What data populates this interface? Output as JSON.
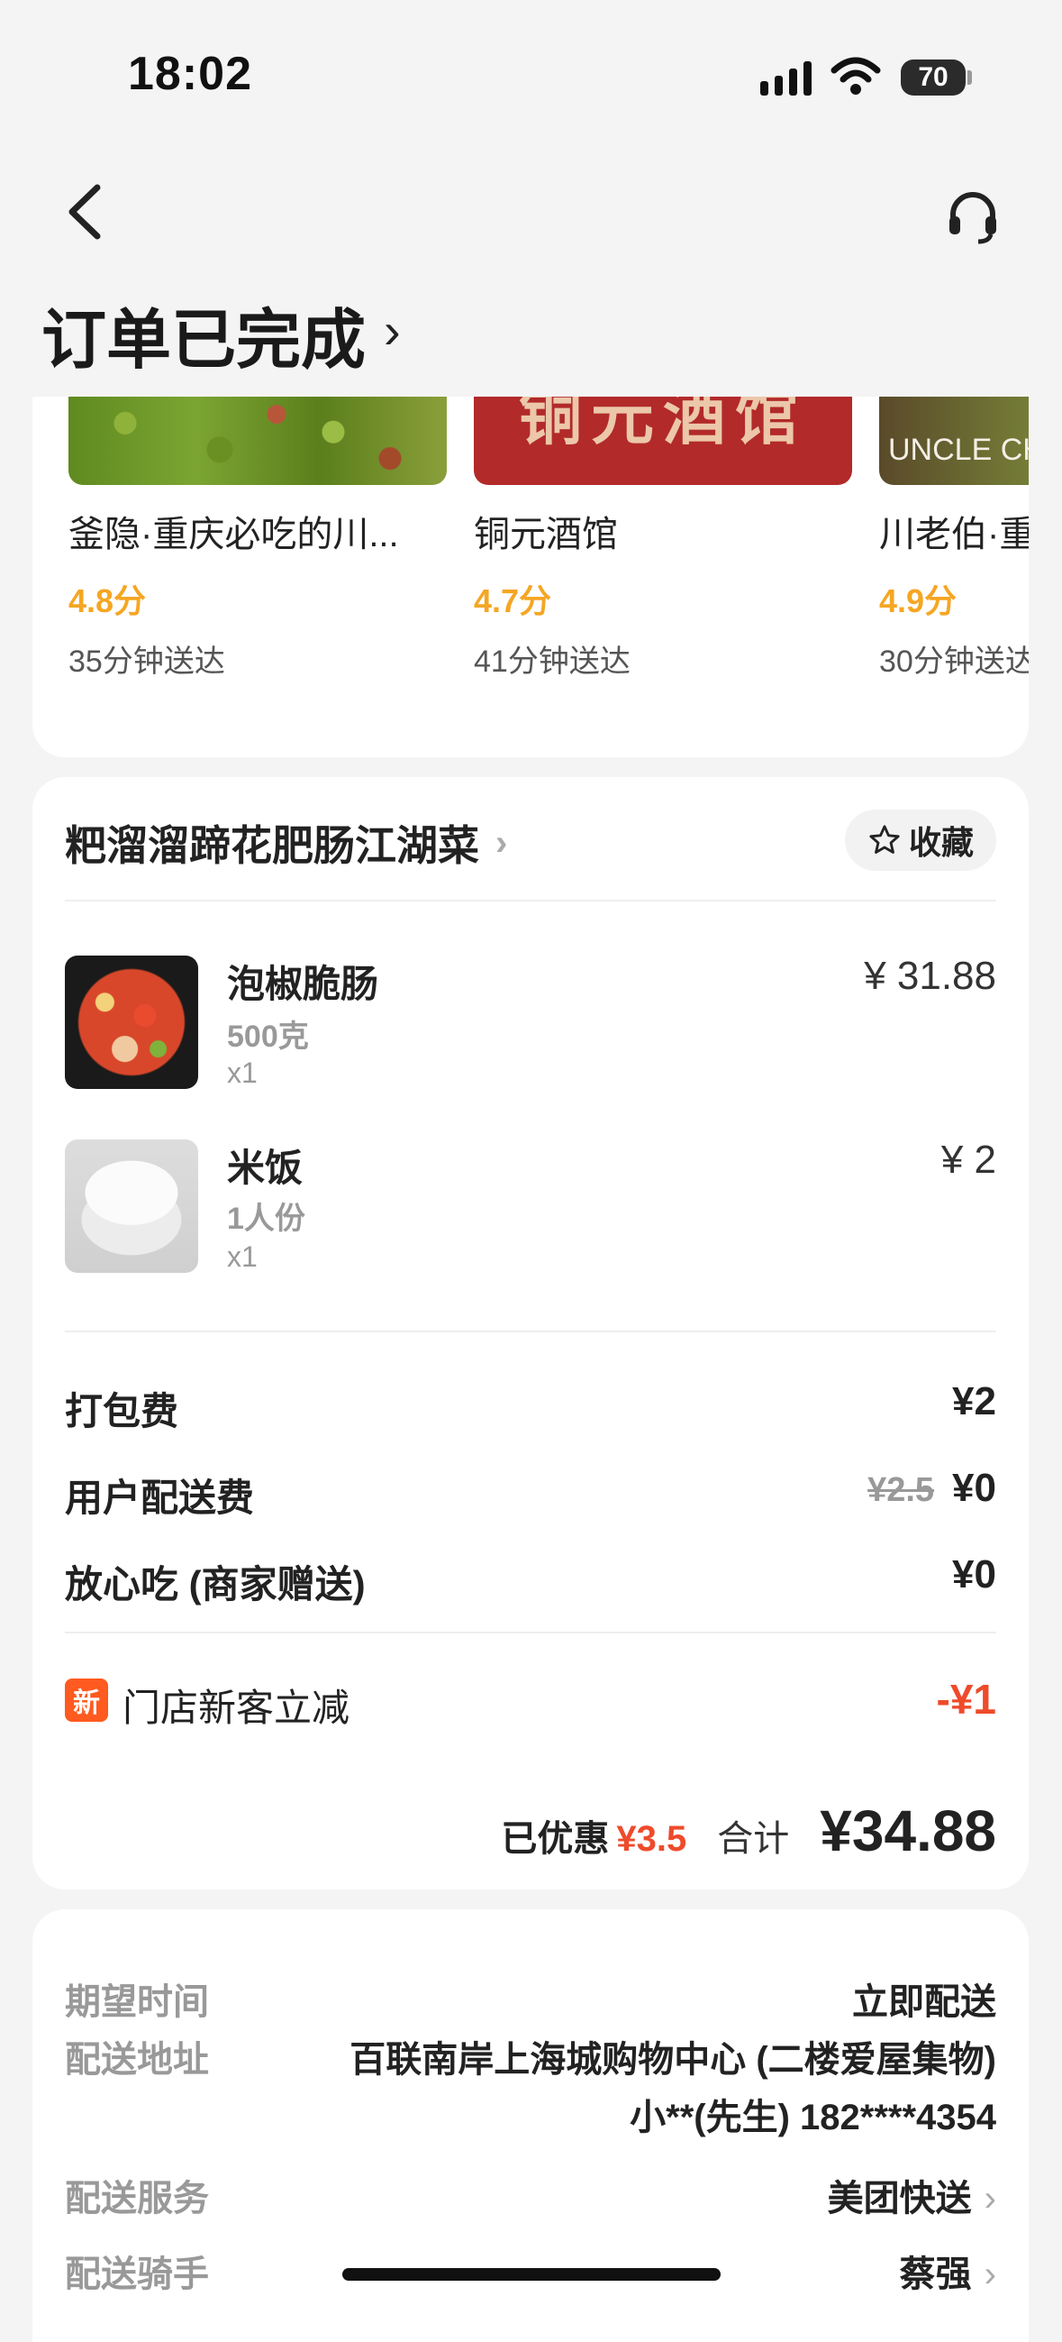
{
  "status_bar": {
    "time": "18:02",
    "battery": "70"
  },
  "header": {
    "title": "订单已完成",
    "title_chevron": "›"
  },
  "recommendations": [
    {
      "name": "釜隐·重庆必吃的川...",
      "rating": "4.8分",
      "delivery_time": "35分钟送达",
      "image_text": ""
    },
    {
      "name": "铜元酒馆",
      "rating": "4.7分",
      "delivery_time": "41分钟送达",
      "image_text": "铜元酒馆"
    },
    {
      "name": "川老伯·重",
      "rating": "4.9分",
      "delivery_time": "30分钟送达",
      "image_text": "UNCLE CHUA"
    }
  ],
  "order": {
    "shop_name": "粑溜溜蹄花肥肠江湖菜",
    "favorite_label": "收藏",
    "items": [
      {
        "name": "泡椒脆肠",
        "spec": "500克",
        "qty": "x1",
        "price": "¥ 31.88"
      },
      {
        "name": "米饭",
        "spec": "1人份",
        "qty": "x1",
        "price": "¥ 2"
      }
    ],
    "fees": [
      {
        "label": "打包费",
        "original": "",
        "value": "¥2"
      },
      {
        "label": "用户配送费",
        "original": "¥2.5",
        "value": "¥0"
      },
      {
        "label": "放心吃 (商家赠送)",
        "original": "",
        "value": "¥0"
      }
    ],
    "promo": {
      "badge": "新",
      "label": "门店新客立减",
      "value": "-¥1"
    },
    "summary": {
      "discount_label": "已优惠",
      "discount_value": "¥3.5",
      "total_label": "合计",
      "total_value": "¥34.88"
    }
  },
  "delivery": {
    "expected_time_label": "期望时间",
    "expected_time_value": "立即配送",
    "address_label": "配送地址",
    "address_line1": "百联南岸上海城购物中心 (二楼爱屋集物)",
    "address_line2": "小**(先生) 182****4354",
    "service_label": "配送服务",
    "service_value": "美团快送",
    "rider_label": "配送骑手",
    "rider_value": "蔡强"
  },
  "colors": {
    "rating": "#f5a623",
    "discount": "#ee4b2b",
    "badge": "#ff5a1f"
  }
}
